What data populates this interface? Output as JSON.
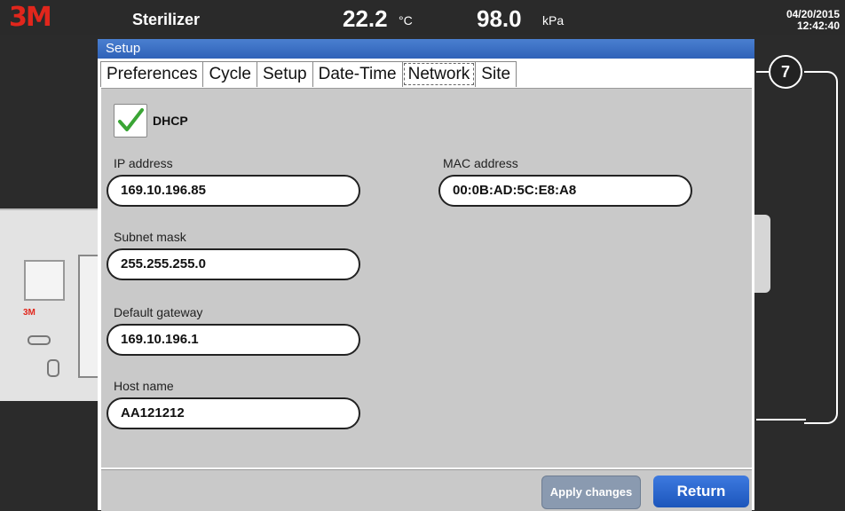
{
  "header": {
    "logo": "3M",
    "device": "Sterilizer",
    "temperature": "22.2",
    "temperature_unit": "°C",
    "pressure": "98.0",
    "pressure_unit": "kPa",
    "date": "04/20/2015",
    "time": "12:42:40"
  },
  "device_logo": "3M",
  "callout": "7",
  "window": {
    "title": "Setup",
    "tabs": [
      "Preferences",
      "Cycle",
      "Setup",
      "Date-Time",
      "Network",
      "Site"
    ],
    "active_tab": "Network"
  },
  "network": {
    "dhcp_label": "DHCP",
    "dhcp_checked": true,
    "ip_label": "IP address",
    "ip_value": "169.10.196.85",
    "mac_label": "MAC address",
    "mac_value": "00:0B:AD:5C:E8:A8",
    "subnet_label": "Subnet mask",
    "subnet_value": "255.255.255.0",
    "gateway_label": "Default gateway",
    "gateway_value": "169.10.196.1",
    "host_label": "Host name",
    "host_value": "AA121212"
  },
  "buttons": {
    "apply": "Apply changes",
    "return": "Return"
  },
  "colors": {
    "accent_blue": "#2f62b8",
    "logo_red": "#e1261c",
    "check_green": "#3aa535"
  }
}
